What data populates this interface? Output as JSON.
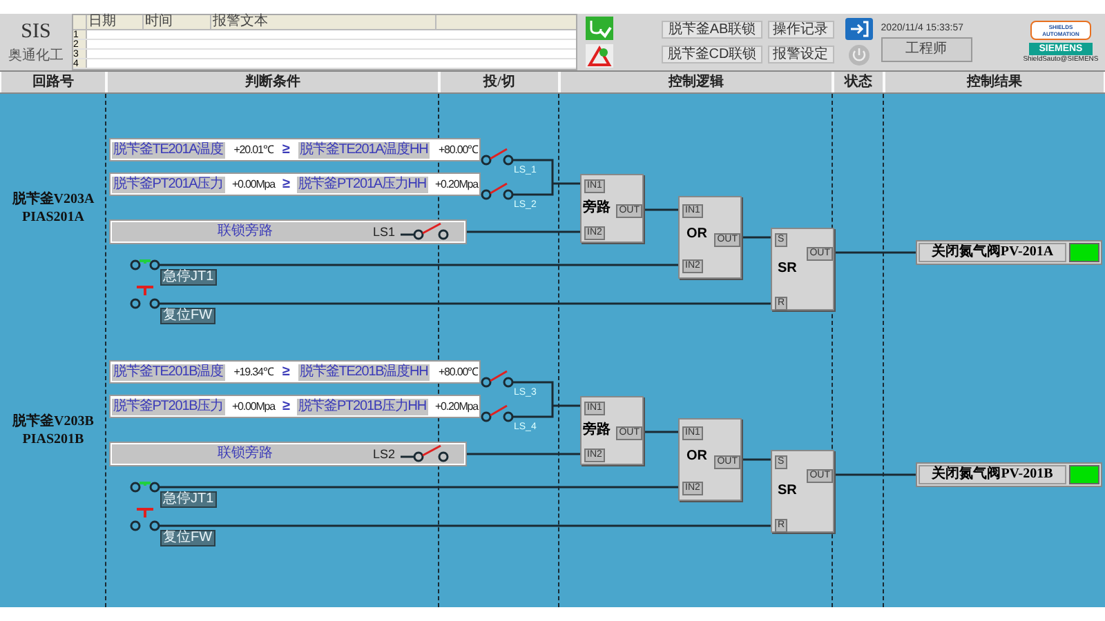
{
  "header": {
    "title": "SIS",
    "company": "奥通化工",
    "alarm_table": {
      "columns": [
        "日期",
        "时间",
        "报警文本"
      ],
      "row_numbers": [
        "1",
        "2",
        "3",
        "4"
      ]
    },
    "buttons": [
      {
        "label": "脱苄釜AB联锁"
      },
      {
        "label": "操作记录"
      },
      {
        "label": "脱苄釜CD联锁"
      },
      {
        "label": "报警设定"
      }
    ],
    "datetime": "2020/11/4 15:33:57",
    "user": "工程师",
    "logo": {
      "line_1": "SHIELDS",
      "line_2": "AUTOMATION",
      "brand": "SIEMENS"
    },
    "caption": "ShieldSauto@SIEMENS"
  },
  "columns": [
    "回路号",
    "判断条件",
    "投/切",
    "控制逻辑",
    "状态",
    "控制结果"
  ],
  "loops": [
    {
      "name": "脱苄釜V203A",
      "tag": "PIAS201A",
      "conditions": [
        {
          "label": "脱苄釜TE201A温度",
          "value": "+20.01℃",
          "op": "≥",
          "limit_label": "脱苄釜TE201A温度HH",
          "limit": "+80.00℃",
          "switch_label": "LS_1",
          "switch_closed": false
        },
        {
          "label": "脱苄釜PT201A压力",
          "value": "+0.00Mpa",
          "op": "≥",
          "limit_label": "脱苄釜PT201A压力HH",
          "limit": "+0.20Mpa",
          "switch_label": "LS_2",
          "switch_closed": false
        }
      ],
      "bypass": {
        "label": "联锁旁路",
        "tag": "LS1",
        "closed": false
      },
      "estop": {
        "label": "急停JT1",
        "closed": true
      },
      "reset": {
        "label": "复位FW",
        "closed": false
      },
      "bypass_block": {
        "title": "旁路",
        "in1": "IN1",
        "in2": "IN2",
        "out": "OUT"
      },
      "or_block": {
        "title": "OR",
        "in1": "IN1",
        "in2": "IN2",
        "out": "OUT"
      },
      "sr_block": {
        "title": "SR",
        "set": "S",
        "reset": "R",
        "out": "OUT"
      },
      "result": {
        "label": "关闭氮气阀PV-201A",
        "on": true
      }
    },
    {
      "name": "脱苄釜V203B",
      "tag": "PIAS201B",
      "conditions": [
        {
          "label": "脱苄釜TE201B温度",
          "value": "+19.34℃",
          "op": "≥",
          "limit_label": "脱苄釜TE201B温度HH",
          "limit": "+80.00℃",
          "switch_label": "LS_3",
          "switch_closed": false
        },
        {
          "label": "脱苄釜PT201B压力",
          "value": "+0.00Mpa",
          "op": "≥",
          "limit_label": "脱苄釜PT201B压力HH",
          "limit": "+0.20Mpa",
          "switch_label": "LS_4",
          "switch_closed": false
        }
      ],
      "bypass": {
        "label": "联锁旁路",
        "tag": "LS2",
        "closed": false
      },
      "estop": {
        "label": "急停JT1",
        "closed": true
      },
      "reset": {
        "label": "复位FW",
        "closed": false
      },
      "bypass_block": {
        "title": "旁路",
        "in1": "IN1",
        "in2": "IN2",
        "out": "OUT"
      },
      "or_block": {
        "title": "OR",
        "in1": "IN1",
        "in2": "IN2",
        "out": "OUT"
      },
      "sr_block": {
        "title": "SR",
        "set": "S",
        "reset": "R",
        "out": "OUT"
      },
      "result": {
        "label": "关闭氮气阀PV-201B",
        "on": true
      }
    }
  ]
}
